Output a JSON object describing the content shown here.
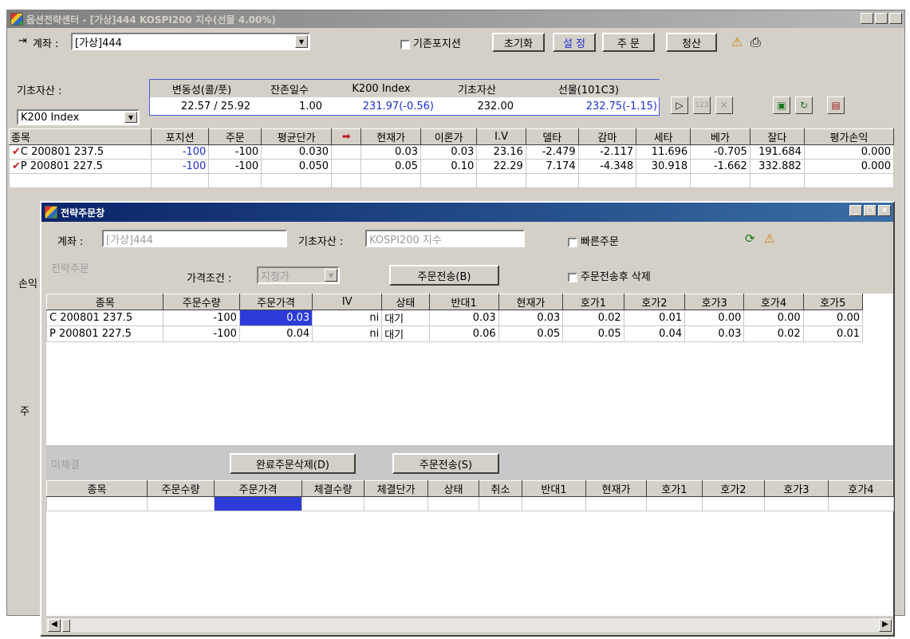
{
  "main": {
    "title": "옵션전략센터 - [가상]444 KOSPI200 지수(선물 4.00%)",
    "account_label": "계좌 :",
    "account_value": "[가상]444",
    "basis_pos_label": "기존포지션",
    "init_btn": "초기화",
    "setting_btn": "설 정",
    "order_btn": "주 문",
    "clear_btn": "청산",
    "base_asset_label": "기초자산 :",
    "base_asset_value": "K200 Index",
    "info_headers": [
      "변동성(콜/풋)",
      "잔존일수",
      "K200 Index",
      "기초자산",
      "선물(101C3)"
    ],
    "info_values": [
      "22.57 / 25.92",
      "1.00",
      "231.97(-0.56)",
      "232.00",
      "232.75(-1.15)"
    ],
    "grid_headers": [
      "종목",
      "포지션",
      "주문",
      "평균단가",
      "",
      "현재가",
      "이론가",
      "I.V",
      "델타",
      "감마",
      "세타",
      "베가",
      "잘다",
      "평가손익"
    ],
    "grid_rows": [
      [
        "C 200801 237.5",
        "-100",
        "-100",
        "0.030",
        "",
        "0.03",
        "0.03",
        "23.16",
        "-2.479",
        "-2.117",
        "11.696",
        "-0.705",
        "191.684",
        "0.000"
      ],
      [
        "P 200801 227.5",
        "-100",
        "-100",
        "0.050",
        "",
        "0.05",
        "0.10",
        "22.29",
        "7.174",
        "-4.348",
        "30.918",
        "-1.662",
        "332.882",
        "0.000"
      ]
    ],
    "side_labels": [
      "손익",
      "주"
    ]
  },
  "dialog": {
    "title": "전략주문창",
    "account_label": "계좌 :",
    "account_value": "[가상]444",
    "base_label": "기초자산 :",
    "base_value": "KOSPI200 지수",
    "fast_order_label": "빠른주문",
    "strategy_label": "전략주문",
    "price_cond_label": "가격조건 :",
    "price_cond_value": "지정가",
    "send_btn": "주문전송(B)",
    "delete_after_label": "주문전송후 삭제",
    "order_headers": [
      "종목",
      "주문수량",
      "주문가격",
      "IV",
      "상태",
      "반대1",
      "현재가",
      "호가1",
      "호가2",
      "호가3",
      "호가4",
      "호가5"
    ],
    "order_rows": [
      [
        "C 200801 237.5",
        "-100",
        "0.03",
        "ni",
        "대기",
        "0.03",
        "0.03",
        "0.02",
        "0.01",
        "0.00",
        "0.00",
        "0.00"
      ],
      [
        "P 200801 227.5",
        "-100",
        "0.04",
        "ni",
        "대기",
        "0.06",
        "0.05",
        "0.05",
        "0.04",
        "0.03",
        "0.02",
        "0.01"
      ]
    ],
    "unfilled_label": "미체결",
    "delete_done_btn": "완료주문삭제(D)",
    "send2_btn": "주문전송(S)",
    "unfilled_headers": [
      "종목",
      "주문수량",
      "주문가격",
      "체결수량",
      "체결단가",
      "상태",
      "취소",
      "반대1",
      "현재가",
      "호가1",
      "호가2",
      "호가3",
      "호가4"
    ]
  },
  "colors": {
    "title_active": "#0a246a",
    "title_inactive": "#808080",
    "selection": "#2d3cd8",
    "check": "#cc2020"
  }
}
